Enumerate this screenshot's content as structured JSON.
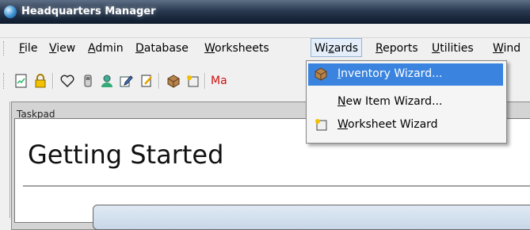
{
  "window": {
    "title": "Headquarters Manager"
  },
  "menubar": {
    "items": [
      {
        "label": "File",
        "accel": "F",
        "rest": "ile"
      },
      {
        "label": "View",
        "accel": "V",
        "rest": "iew"
      },
      {
        "label": "Admin",
        "accel": "A",
        "rest": "dmin"
      },
      {
        "label": "Database",
        "accel": "D",
        "rest": "atabase"
      },
      {
        "label": "Worksheets",
        "accel": "W",
        "rest": "orksheets"
      },
      {
        "label": "Wizards",
        "pre": "Wi",
        "accel": "z",
        "rest": "ards"
      },
      {
        "label": "Reports",
        "accel": "R",
        "rest": "eports"
      },
      {
        "label": "Utilities",
        "accel": "U",
        "rest": "tilities"
      },
      {
        "label": "Wind",
        "accel": "W",
        "rest": "ind"
      }
    ]
  },
  "toolbar": {
    "truncated_text": "Ma"
  },
  "wizards_menu": {
    "items": [
      {
        "label": "Inventory Wizard...",
        "accel": "I",
        "rest": "nventory Wizard...",
        "icon": "box-icon",
        "highlighted": true
      },
      {
        "label": "New Item Wizard...",
        "accel": "N",
        "rest": "ew Item Wizard...",
        "icon": "",
        "highlighted": false
      },
      {
        "label": "Worksheet Wizard",
        "accel": "W",
        "rest": "orksheet Wizard",
        "icon": "worksheet-wizard-icon",
        "highlighted": false
      }
    ]
  },
  "taskpad": {
    "caption": "Taskpad",
    "heading": "Getting Started"
  },
  "colors": {
    "highlight": "#3a84e0",
    "toolbar_text": "#cc1111"
  }
}
